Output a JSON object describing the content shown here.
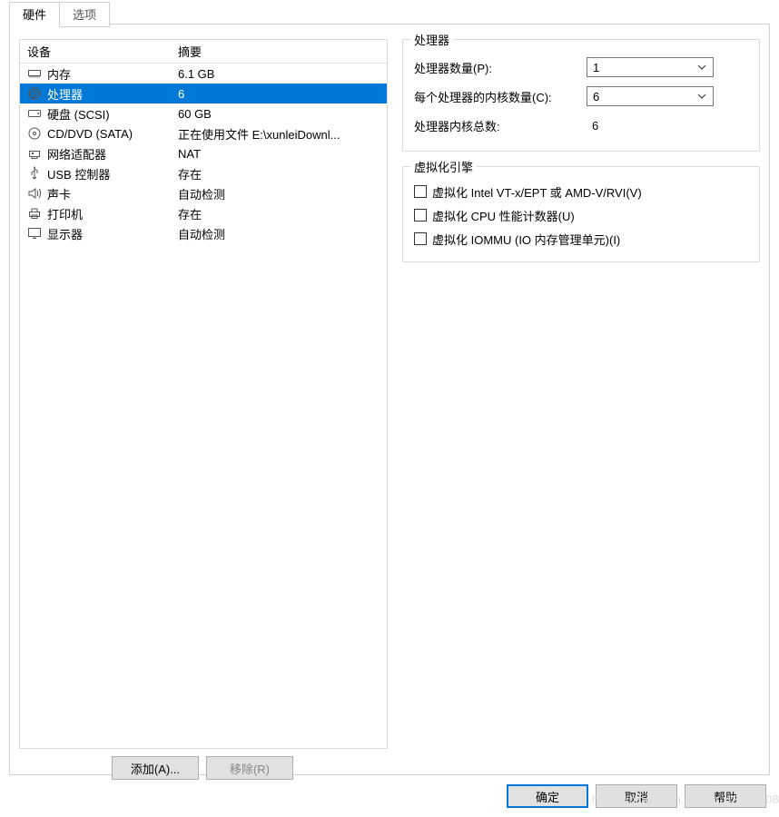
{
  "tabs": {
    "hardware": "硬件",
    "options": "选项"
  },
  "columns": {
    "device": "设备",
    "summary": "摘要"
  },
  "devices": [
    {
      "icon": "memory",
      "name": "内存",
      "summary": "6.1 GB"
    },
    {
      "icon": "cpu",
      "name": "处理器",
      "summary": "6",
      "selected": true
    },
    {
      "icon": "disk",
      "name": "硬盘 (SCSI)",
      "summary": "60 GB"
    },
    {
      "icon": "cd",
      "name": "CD/DVD (SATA)",
      "summary": "正在使用文件 E:\\xunleiDownl..."
    },
    {
      "icon": "net",
      "name": "网络适配器",
      "summary": "NAT"
    },
    {
      "icon": "usb",
      "name": "USB 控制器",
      "summary": "存在"
    },
    {
      "icon": "sound",
      "name": "声卡",
      "summary": "自动检测"
    },
    {
      "icon": "printer",
      "name": "打印机",
      "summary": "存在"
    },
    {
      "icon": "display",
      "name": "显示器",
      "summary": "自动检测"
    }
  ],
  "leftButtons": {
    "add": "添加(A)...",
    "remove": "移除(R)"
  },
  "proc": {
    "legend": "处理器",
    "countLabel": "处理器数量(P):",
    "countValue": "1",
    "coresLabel": "每个处理器的内核数量(C):",
    "coresValue": "6",
    "totalLabel": "处理器内核总数:",
    "totalValue": "6"
  },
  "virt": {
    "legend": "虚拟化引擎",
    "opt1": "虚拟化 Intel VT-x/EPT 或 AMD-V/RVI(V)",
    "opt2": "虚拟化 CPU 性能计数器(U)",
    "opt3": "虚拟化 IOMMU (IO 内存管理单元)(I)"
  },
  "dialogButtons": {
    "ok": "确定",
    "cancel": "取消",
    "help": "帮助"
  },
  "watermark": "https://blog.csdn.net/qq_43105308"
}
